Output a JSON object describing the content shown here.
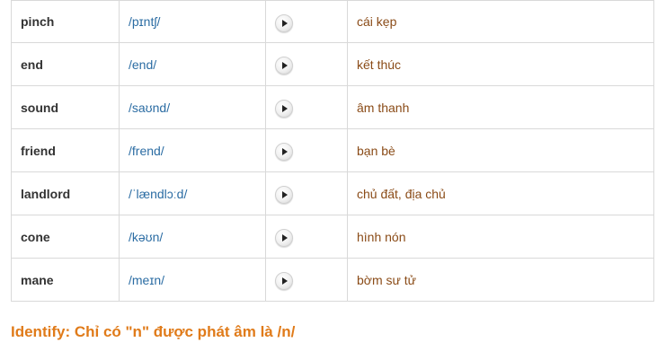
{
  "rows": [
    {
      "word": "pinch",
      "ipa": "/pɪntʃ/",
      "meaning": "cái kẹp"
    },
    {
      "word": "end",
      "ipa": "/end/",
      "meaning": "kết thúc"
    },
    {
      "word": "sound",
      "ipa": "/saʊnd/",
      "meaning": "âm thanh"
    },
    {
      "word": "friend",
      "ipa": "/frend/",
      "meaning": "bạn bè"
    },
    {
      "word": "landlord",
      "ipa": "/ˈlændlɔːd/",
      "meaning": "chủ đất, địa chủ"
    },
    {
      "word": "cone",
      "ipa": "/kəʊn/",
      "meaning": "hình nón"
    },
    {
      "word": "mane",
      "ipa": "/meɪn/",
      "meaning": "bờm sư tử"
    }
  ],
  "audio_icon": "play-icon",
  "identify_text": "Identify: Chỉ có \"n\" được phát âm là /n/",
  "colors": {
    "ipa": "#2b6ca3",
    "meaning": "#8a4b17",
    "identify": "#e07b1a",
    "border": "#d9d9d9"
  }
}
